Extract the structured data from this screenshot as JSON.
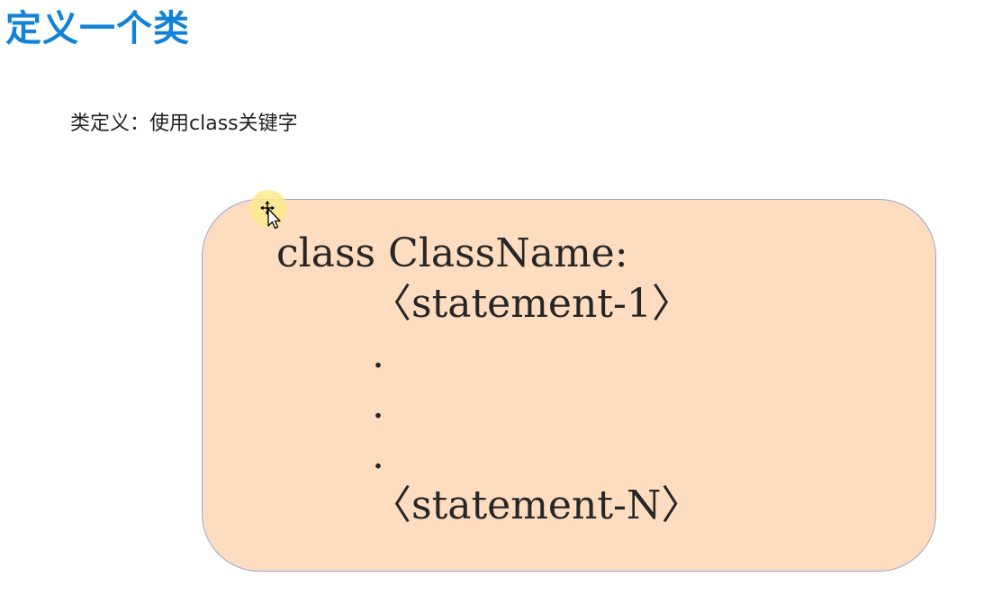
{
  "slide": {
    "title": "定义一个类",
    "subtitle": "类定义：使用class关键字"
  },
  "code": {
    "lines": [
      "class ClassName:",
      "〈statement-1〉",
      ".",
      ".",
      ".",
      "〈statement-N〉"
    ]
  },
  "cursor": {
    "icon": "move-pointer-icon"
  },
  "colors": {
    "title": "#1282d6",
    "box_fill": "#fddcbf",
    "box_border": "#9aa2cc",
    "cursor_highlight": "#fdea8c"
  }
}
